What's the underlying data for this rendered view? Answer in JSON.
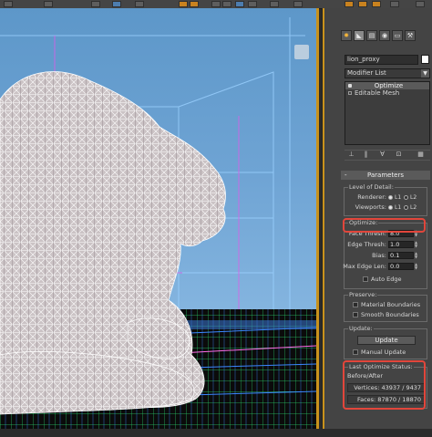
{
  "command_panel": {
    "tabs": [
      "sun-icon",
      "modify-icon",
      "hierarchy-icon",
      "motion-icon",
      "display-icon",
      "utilities-icon"
    ],
    "object_name": "lion_proxy",
    "object_color": "#ffffff",
    "modifier_list": "Modifier List",
    "stack": [
      {
        "label": "Optimize",
        "selected": true
      },
      {
        "label": "Editable Mesh",
        "selected": false
      }
    ]
  },
  "parameters": {
    "title": "Parameters",
    "lod": {
      "label": "Level of Detail:",
      "renderer_label": "Renderer:",
      "viewports_label": "Viewports:",
      "l1": "L1",
      "l2": "L2"
    },
    "optimize": {
      "label": "Optimize:",
      "face_thresh_label": "Face Thresh:",
      "face_thresh_value": "8.0",
      "edge_thresh_label": "Edge Thresh:",
      "edge_thresh_value": "1.0",
      "bias_label": "Bias:",
      "bias_value": "0.1",
      "max_edge_len_label": "Max Edge Len:",
      "max_edge_len_value": "0.0",
      "auto_edge_label": "Auto Edge"
    },
    "preserve": {
      "label": "Preserve:",
      "material_boundaries_label": "Material Boundaries",
      "smooth_boundaries_label": "Smooth Boundaries"
    },
    "update": {
      "label": "Update:",
      "update_button": "Update",
      "manual_update_label": "Manual Update"
    },
    "status": {
      "label": "Last Optimize Status:",
      "before_after": "Before/After",
      "vertices": "Vertices: 43937 / 9437",
      "faces": "Faces: 87870 / 18870"
    }
  },
  "colors": {
    "accent": "#c9921c",
    "highlight": "#e2463b",
    "panel_bg": "#444444"
  }
}
